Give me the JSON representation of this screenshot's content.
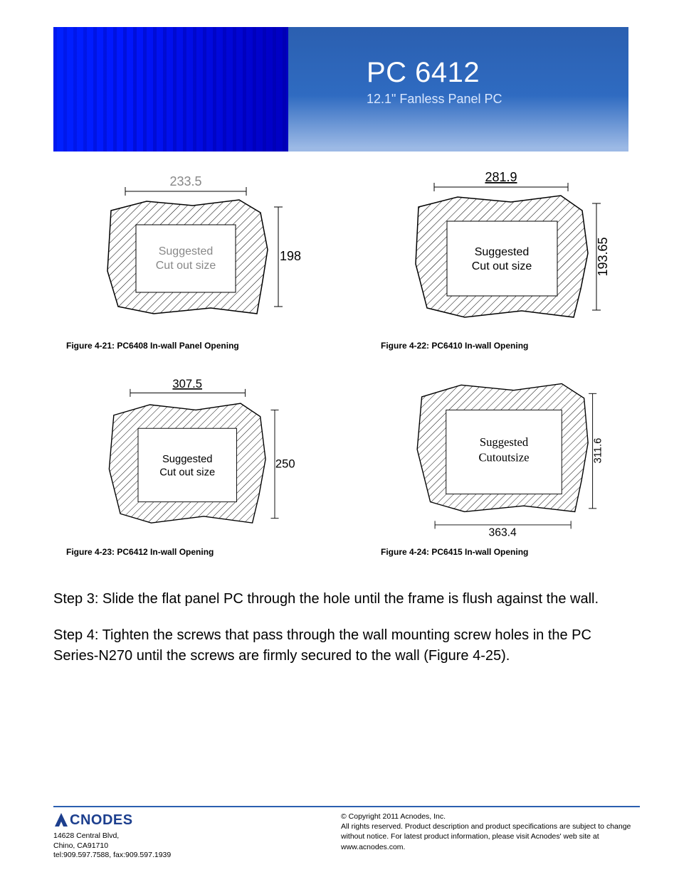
{
  "header": {
    "model": "PC 6412",
    "subtitle": "12.1\" Fanless Panel PC"
  },
  "figures": [
    {
      "width_val": "233.5",
      "height_val": "198",
      "cut_label1": "Suggested",
      "cut_label2": "Cut out size",
      "caption": "Figure 4-21: PC6408 In-wall Panel Opening",
      "top_dim_pos": "top",
      "right_dim_pos": "right"
    },
    {
      "width_val": "281.9",
      "height_val": "193.65",
      "cut_label1": "Suggested",
      "cut_label2": "Cut out size",
      "caption": "Figure 4-22: PC6410 In-wall Opening",
      "top_dim_pos": "top",
      "right_dim_pos": "right-rot"
    },
    {
      "width_val": "307.5",
      "height_val": "250",
      "cut_label1": "Suggested",
      "cut_label2": "Cut out size",
      "caption": "Figure 4-23: PC6412 In-wall Opening",
      "top_dim_pos": "top",
      "right_dim_pos": "right"
    },
    {
      "width_val": "363.4",
      "height_val": "311.6",
      "cut_label1": "Suggested",
      "cut_label2": "Cutoutsize",
      "caption": "Figure 4-24: PC6415 In-wall Opening",
      "top_dim_pos": "bottom",
      "right_dim_pos": "right-rot"
    }
  ],
  "steps": {
    "step3": "Step 3:   Slide the flat panel PC through the hole until the frame is flush against the wall.",
    "step4": "Step 4:   Tighten the screws that pass through the wall mounting screw holes in the PC Series-N270 until the screws are firmly secured to the wall (Figure 4-25)."
  },
  "footer": {
    "logo_text": "CNODES",
    "address1": "14628 Central Blvd,",
    "address2": "Chino, CA91710",
    "contact": "tel:909.597.7588, fax:909.597.1939",
    "copy1": "© Copyright 2011 Acnodes, Inc.",
    "copy2": "All rights reserved. Product description and product specifications are subject to change without notice. For latest product information, please visit Acnodes' web site at www.acnodes.com."
  }
}
